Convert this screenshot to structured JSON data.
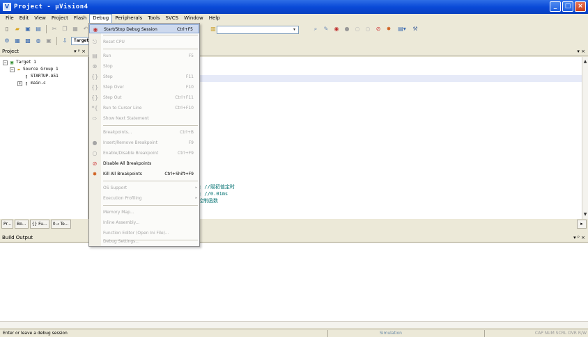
{
  "window": {
    "title": "Project  - µVision4",
    "icon": "uvision-logo",
    "buttons": {
      "minimize": "_",
      "maximize": "□",
      "close": "×"
    }
  },
  "menubar": {
    "items": [
      "File",
      "Edit",
      "View",
      "Project",
      "Flash",
      "Debug",
      "Peripherals",
      "Tools",
      "SVCS",
      "Window",
      "Help"
    ],
    "active": "Debug"
  },
  "toolbar": {
    "target": "Target"
  },
  "project_pane": {
    "title": "Project",
    "controls": "▾ ᵖ ×",
    "tree": {
      "root": "Target 1",
      "group": "Source Group 1",
      "files": [
        "STARTUP.A51",
        "main.c"
      ]
    },
    "tabs": [
      "Pr...",
      "Bo...",
      "{} Fu...",
      "0→ Te..."
    ]
  },
  "editor": {
    "controls": "▾ ×",
    "code_lines": [
      "; //赋初值定时",
      "; //0.01ms",
      "控制函数"
    ]
  },
  "debug_menu": {
    "items": [
      {
        "icon": "start-stop-debug-icon",
        "label": "Start/Stop Debug Session",
        "shortcut": "Ctrl+F5",
        "enabled": true,
        "highlighted": true
      },
      {
        "icon": "reset-cpu-icon",
        "label": "Reset CPU",
        "shortcut": "",
        "enabled": false
      },
      {
        "icon": "run-icon",
        "label": "Run",
        "shortcut": "F5",
        "enabled": false
      },
      {
        "icon": "stop-icon",
        "label": "Stop",
        "shortcut": "",
        "enabled": false
      },
      {
        "icon": "step-icon",
        "label": "Step",
        "shortcut": "F11",
        "enabled": false
      },
      {
        "icon": "step-over-icon",
        "label": "Step Over",
        "shortcut": "F10",
        "enabled": false
      },
      {
        "icon": "step-out-icon",
        "label": "Step Out",
        "shortcut": "Ctrl+F11",
        "enabled": false
      },
      {
        "icon": "run-to-cursor-icon",
        "label": "Run to Cursor Line",
        "shortcut": "Ctrl+F10",
        "enabled": false
      },
      {
        "icon": "show-next-statement-icon",
        "label": "Show Next Statement",
        "shortcut": "",
        "enabled": false
      },
      {
        "icon": "",
        "label": "Breakpoints...",
        "shortcut": "Ctrl+B",
        "enabled": false
      },
      {
        "icon": "insert-breakpoint-icon",
        "label": "Insert/Remove Breakpoint",
        "shortcut": "F9",
        "enabled": false
      },
      {
        "icon": "enable-breakpoint-icon",
        "label": "Enable/Disable Breakpoint",
        "shortcut": "Ctrl+F9",
        "enabled": false
      },
      {
        "icon": "disable-all-breakpoints-icon",
        "label": "Disable All Breakpoints",
        "shortcut": "",
        "enabled": true
      },
      {
        "icon": "kill-all-breakpoints-icon",
        "label": "Kill All Breakpoints",
        "shortcut": "Ctrl+Shift+F9",
        "enabled": true
      },
      {
        "icon": "",
        "label": "OS Support",
        "shortcut": "",
        "enabled": false,
        "submenu": true
      },
      {
        "icon": "",
        "label": "Execution Profiling",
        "shortcut": "",
        "enabled": false,
        "submenu": true
      },
      {
        "icon": "",
        "label": "Memory Map...",
        "shortcut": "",
        "enabled": false
      },
      {
        "icon": "",
        "label": "Inline Assembly...",
        "shortcut": "",
        "enabled": false
      },
      {
        "icon": "",
        "label": "Function Editor (Open Ini File)...",
        "shortcut": "",
        "enabled": false
      },
      {
        "icon": "",
        "label": "Debug Settings...",
        "shortcut": "",
        "enabled": false
      }
    ]
  },
  "build_output": {
    "title": "Build Output",
    "controls": "▾ ᵖ ×"
  },
  "statusbar": {
    "message": "Enter or leave a debug session",
    "mode": "Simulation",
    "keys": "CAP  NUM  SCRL  OVR  R/W"
  },
  "colors": {
    "titlebar": "#0a4ad8",
    "menu_highlight": "#cdd9ee",
    "code_comment": "#007070"
  }
}
